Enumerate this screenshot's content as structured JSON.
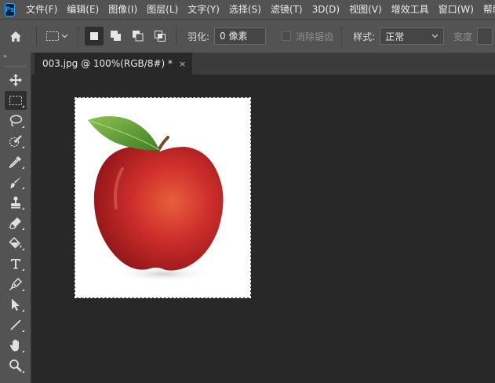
{
  "app": {
    "logo": "Ps"
  },
  "menu": [
    "文件(F)",
    "编辑(E)",
    "图像(I)",
    "图层(L)",
    "文字(Y)",
    "选择(S)",
    "滤镜(T)",
    "3D(D)",
    "视图(V)",
    "增效工具",
    "窗口(W)",
    "帮助(H)"
  ],
  "options": {
    "feather_label": "羽化:",
    "feather_value": "0 像素",
    "antialias_label": "消除锯齿",
    "style_label": "样式:",
    "style_value": "正常",
    "width_label": "宽度"
  },
  "document": {
    "tab_title": "003.jpg @ 100%(RGB/8#) *",
    "close": "×"
  },
  "toolbar": {
    "collapse": "»",
    "tools": [
      "move-tool",
      "rectangular-marquee-tool",
      "lasso-tool",
      "quick-selection-tool",
      "eyedropper-tool",
      "brush-tool",
      "clone-stamp-tool",
      "eraser-tool",
      "paint-bucket-tool",
      "type-tool",
      "pen-tool",
      "path-selection-tool",
      "line-tool",
      "hand-tool",
      "zoom-tool"
    ],
    "active": "rectangular-marquee-tool"
  },
  "colors": {
    "ui_panel": "#535353",
    "canvas_bg": "#282828",
    "ps_blue": "#31a8ff",
    "apple_red": "#c8282c",
    "leaf_green": "#6aa53a"
  }
}
